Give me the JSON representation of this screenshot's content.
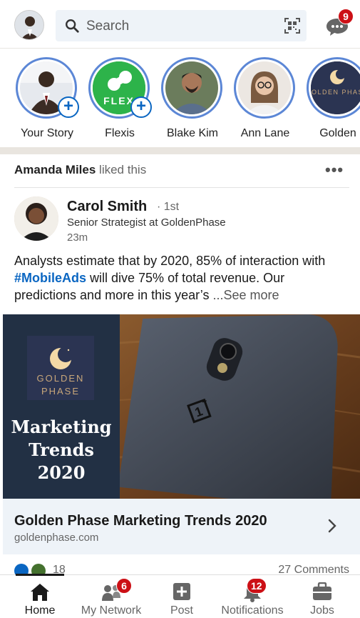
{
  "header": {
    "search_placeholder": "Search",
    "messages_badge": "9"
  },
  "stories": [
    {
      "label": "Your Story",
      "has_plus": true
    },
    {
      "label": "Flexis",
      "has_plus": true,
      "logo_text": "FLEX"
    },
    {
      "label": "Blake Kim",
      "has_plus": false
    },
    {
      "label": "Ann Lane",
      "has_plus": false
    },
    {
      "label": "Golden",
      "has_plus": false,
      "logo_text": "GOLDEN PHASE"
    }
  ],
  "post": {
    "activity_actor": "Amanda Miles",
    "activity_text": "liked this",
    "author_name": "Carol Smith",
    "author_degree": "· 1st",
    "author_title": "Senior Strategist at GoldenPhase",
    "author_time": "23m",
    "text_before": "Analysts estimate that by 2020, 85% of interaction with ",
    "hashtag": "#MobileAds",
    "text_after": " will dive 75% of total revenue. Our predictions and more in this year’s ",
    "see_more": "...See more",
    "image": {
      "logo_line1": "GOLDEN",
      "logo_line2": "PHASE",
      "trend_line1": "Marketing",
      "trend_line2": "Trends",
      "trend_line3": "2020"
    },
    "link_title": "Golden Phase Marketing Trends 2020",
    "link_domain": "goldenphase.com",
    "reactions_count": "18",
    "comments_count": "27 Comments"
  },
  "nav": {
    "items": [
      {
        "label": "Home",
        "active": true
      },
      {
        "label": "My Network",
        "badge": "6"
      },
      {
        "label": "Post"
      },
      {
        "label": "Notifications",
        "badge": "12"
      },
      {
        "label": "Jobs"
      }
    ]
  },
  "colors": {
    "brand_blue": "#0a66c2",
    "badge_red": "#cc1016",
    "story_ring": "#5c87d6",
    "flexis_green": "#2db34a"
  }
}
